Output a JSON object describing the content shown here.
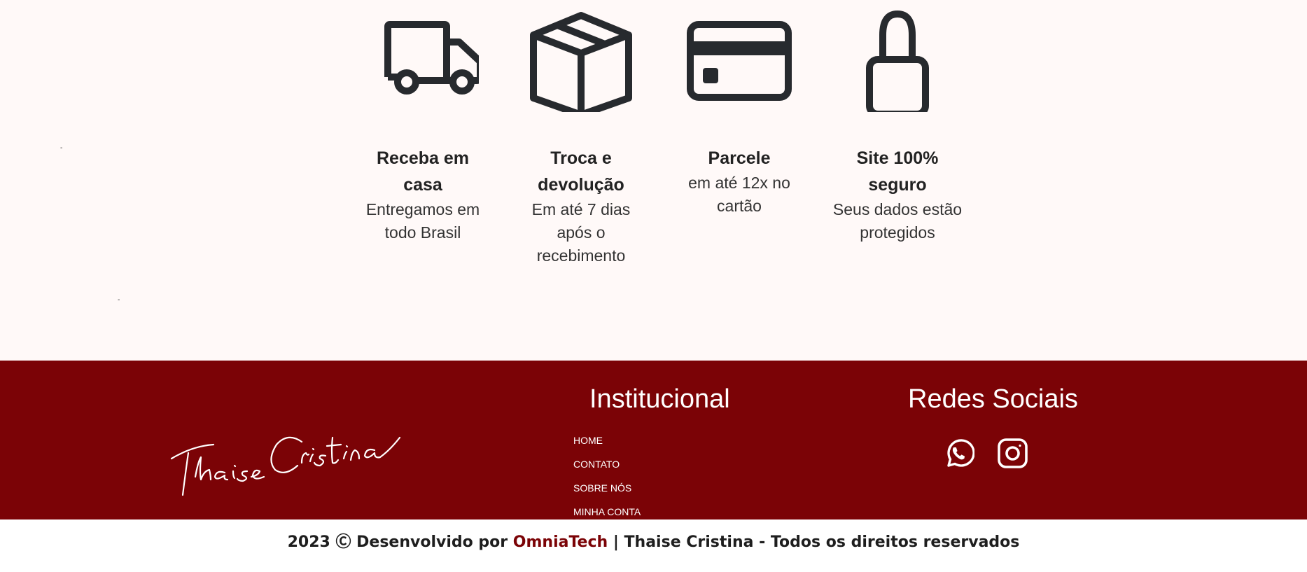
{
  "features": [
    {
      "icon": "truck-icon",
      "title": "Receba em casa",
      "desc": "Entregamos em todo Brasil"
    },
    {
      "icon": "box-icon",
      "title": "Troca e devolução",
      "desc": "Em até 7 dias após o recebimento"
    },
    {
      "icon": "credit-card-icon",
      "title": "Parcele",
      "desc": "em até 12x no cartão"
    },
    {
      "icon": "lock-icon",
      "title": "Site 100% seguro",
      "desc": "Seus dados estão protegidos"
    }
  ],
  "stray_marks": [
    "-",
    "-"
  ],
  "footer": {
    "logo_text": "Thaise Cristina",
    "institutional": {
      "title": "Institucional",
      "links": [
        "HOME",
        "CONTATO",
        "SOBRE NÓS",
        "MINHA CONTA"
      ]
    },
    "social": {
      "title": "Redes Sociais",
      "icons": [
        "whatsapp-icon",
        "instagram-icon"
      ]
    }
  },
  "copyright": {
    "prefix": "2023 Ⓒ Desenvolvido por ",
    "brand": "OmniaTech",
    "suffix": " | Thaise Cristina - Todos os direitos reservados"
  },
  "colors": {
    "footer_bg": "#7b0306",
    "features_bg": "#fff9f8",
    "icon_stroke": "#272a2e"
  }
}
